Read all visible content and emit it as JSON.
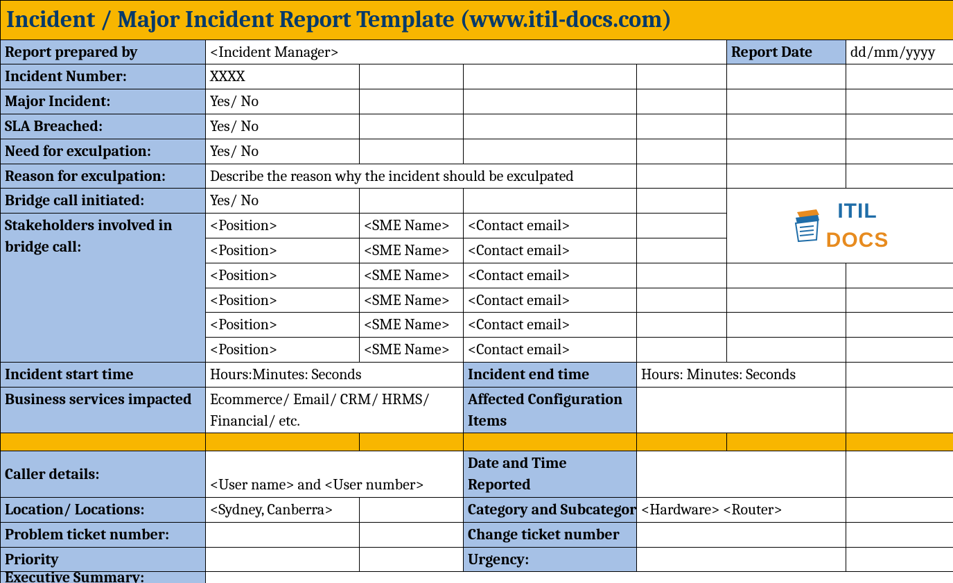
{
  "title": "Incident / Major Incident Report Template   (www.itil-docs.com)",
  "labels": {
    "report_prepared_by": "Report prepared by",
    "report_date": "Report Date",
    "incident_number": "Incident Number:",
    "major_incident": "Major Incident:",
    "sla_breached": "SLA Breached:",
    "need_exculpation": "Need for exculpation:",
    "reason_exculpation": "Reason for exculpation:",
    "bridge_call": "Bridge call initiated:",
    "stakeholders": "Stakeholders involved in bridge call:",
    "incident_start": "Incident start time",
    "incident_end": "Incident end time",
    "business_services": "Business services impacted",
    "affected_ci": "Affected Configuration Items",
    "caller_details": "Caller details:",
    "date_time_reported": "Date and Time Reported",
    "location": "Location/ Locations:",
    "category_subcat": "Category and Subcategory",
    "problem_ticket": "Problem ticket number:",
    "change_ticket": "Change ticket number",
    "priority": "Priority",
    "urgency": "Urgency:",
    "exec_summary": "Executive Summary:"
  },
  "values": {
    "report_prepared_by": "<Incident Manager>",
    "report_date": "dd/mm/yyyy",
    "incident_number": "XXXX",
    "major_incident": "Yes/ No",
    "sla_breached": "Yes/ No",
    "need_exculpation": "Yes/ No",
    "reason_exculpation": "Describe the reason why the incident should be exculpated",
    "bridge_call": "Yes/ No",
    "incident_start": "Hours:Minutes: Seconds",
    "incident_end": "Hours: Minutes: Seconds",
    "business_services": "Ecommerce/ Email/ CRM/ HRMS/ Financial/ etc.",
    "caller_details": "<User name> and <User number>",
    "location": "<Sydney, Canberra>",
    "category_subcat": "<Hardware> <Router>"
  },
  "stakeholders": [
    {
      "position": "<Position>",
      "sme": "<SME Name>",
      "email": "<Contact email>"
    },
    {
      "position": "<Position>",
      "sme": "<SME Name>",
      "email": "<Contact email>"
    },
    {
      "position": "<Position>",
      "sme": "<SME Name>",
      "email": "<Contact email>"
    },
    {
      "position": "<Position>",
      "sme": "<SME Name>",
      "email": "<Contact email>"
    },
    {
      "position": "<Position>",
      "sme": "<SME Name>",
      "email": "<Contact email>"
    },
    {
      "position": "<Position>",
      "sme": "<SME Name>",
      "email": "<Contact email>"
    }
  ],
  "logo": {
    "part1": "ITIL",
    "part2": "DOCS"
  }
}
